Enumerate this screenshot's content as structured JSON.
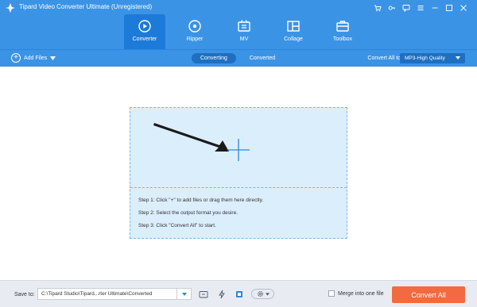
{
  "window": {
    "title": "Tipard Video Converter Ultimate (Unregistered)",
    "controls": [
      "cart-icon",
      "key-icon",
      "feedback-icon",
      "menu-icon",
      "minimize-icon",
      "maximize-icon",
      "close-icon"
    ]
  },
  "nav": {
    "items": [
      {
        "label": "Converter",
        "icon": "converter-icon",
        "active": true
      },
      {
        "label": "Ripper",
        "icon": "ripper-icon",
        "active": false
      },
      {
        "label": "MV",
        "icon": "mv-icon",
        "active": false
      },
      {
        "label": "Collage",
        "icon": "collage-icon",
        "active": false
      },
      {
        "label": "Toolbox",
        "icon": "toolbox-icon",
        "active": false
      }
    ]
  },
  "toolbar": {
    "add_files_label": "Add Files",
    "tabs": [
      {
        "label": "Converting",
        "active": true
      },
      {
        "label": "Converted",
        "active": false
      }
    ],
    "convert_all_to_label": "Convert All to:",
    "format_value": "MP3-High Quality"
  },
  "dropzone": {
    "steps": [
      "Step 1: Click \"+\" to add files or drag them here directly.",
      "Step 2: Select the output format you desire.",
      "Step 3: Click \"Convert All\" to start."
    ]
  },
  "bottom": {
    "save_to_label": "Save to:",
    "save_path": "C:\\Tipard Studio\\Tipard...rter Ultimate\\Converted",
    "merge_label": "Merge into one file",
    "merge_checked": false,
    "convert_all_label": "Convert All"
  },
  "colors": {
    "header_bg": "#3b93e6",
    "active_tab_bg": "#1c7bd8",
    "dropzone_bg": "#dbeefc",
    "convert_button": "#f26a3f"
  }
}
